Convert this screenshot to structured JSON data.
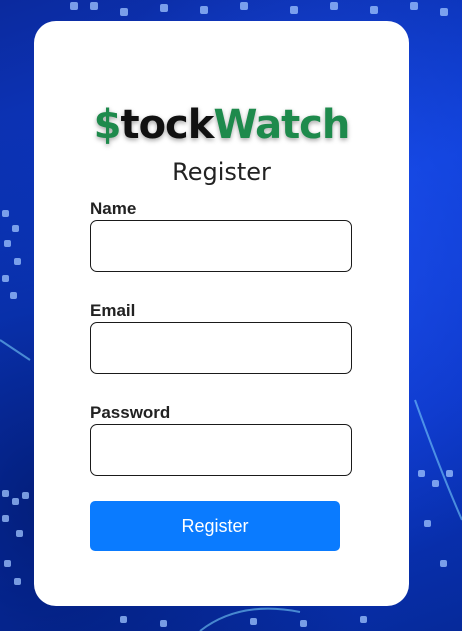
{
  "brand": {
    "prefix": "$",
    "middle": "tock",
    "suffix": "Watch"
  },
  "form": {
    "title": "Register",
    "name_label": "Name",
    "name_value": "",
    "email_label": "Email",
    "email_value": "",
    "password_label": "Password",
    "password_value": "",
    "submit_label": "Register"
  },
  "colors": {
    "brand_green": "#1e8a4c",
    "button_blue": "#0a7bff",
    "background_blue": "#0a2fb8"
  }
}
